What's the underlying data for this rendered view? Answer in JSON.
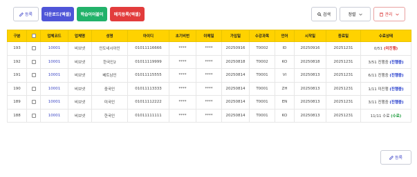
{
  "toolbar": {
    "register_label": "등록",
    "download_label": "다운로드(엑셀)",
    "study_label": "학습이어붙이",
    "bulk_register_label": "예치등록(엑셀)",
    "search_label": "검색",
    "sort_label": "정렬",
    "manage_label": "관리"
  },
  "colors": {
    "header_bg": "#ffd200",
    "accent": "#4f55d8",
    "green": "#22b26a",
    "red": "#e23c3c"
  },
  "table": {
    "columns": [
      "구분",
      "",
      "업체코드",
      "업체명",
      "성명",
      "아이디",
      "초기비번",
      "이메일",
      "가입일",
      "수강과목",
      "언어",
      "시작일",
      "종료일",
      "수료상태"
    ],
    "rows": [
      {
        "no": "193",
        "code": "10001",
        "company": "비브넷",
        "name": "인도네시아인",
        "id": "01011116666",
        "pw": "****",
        "email": "****",
        "joined": "20250916",
        "course": "T0002",
        "lang": "ID",
        "start": "20250916",
        "end": "20251231",
        "progress": "0/51",
        "status": "미진행",
        "status_type": "red"
      },
      {
        "no": "192",
        "code": "10001",
        "company": "비브넷",
        "name": "한국인2",
        "id": "01011119999",
        "pw": "****",
        "email": "****",
        "joined": "20250818",
        "course": "T0002",
        "lang": "KO",
        "start": "20250818",
        "end": "20251231",
        "progress": "3/51 진행중",
        "status": "진행중",
        "status_type": "blue"
      },
      {
        "no": "191",
        "code": "10001",
        "company": "비브넷",
        "name": "베트남인",
        "id": "01011115555",
        "pw": "****",
        "email": "****",
        "joined": "20250814",
        "course": "T0001",
        "lang": "VI",
        "start": "20250813",
        "end": "20251231",
        "progress": "6/11 진행중",
        "status": "진행중",
        "status_type": "blue"
      },
      {
        "no": "190",
        "code": "10001",
        "company": "비브넷",
        "name": "중국인",
        "id": "01011113333",
        "pw": "****",
        "email": "****",
        "joined": "20250814",
        "course": "T0001",
        "lang": "ZH",
        "start": "20250813",
        "end": "20251231",
        "progress": "1/11 미진행",
        "status": "진행중",
        "status_type": "blue"
      },
      {
        "no": "189",
        "code": "10001",
        "company": "비브넷",
        "name": "미국인",
        "id": "01011112222",
        "pw": "****",
        "email": "****",
        "joined": "20250814",
        "course": "T0001",
        "lang": "EN",
        "start": "20250813",
        "end": "20251231",
        "progress": "3/11 진행중",
        "status": "진행중",
        "status_type": "blue"
      },
      {
        "no": "188",
        "code": "10001",
        "company": "비브넷",
        "name": "한국인",
        "id": "01011111111",
        "pw": "****",
        "email": "****",
        "joined": "20250814",
        "course": "T0001",
        "lang": "KO",
        "start": "20250813",
        "end": "20251231",
        "progress": "11/11 수료",
        "status": "수료",
        "status_type": "green"
      }
    ]
  },
  "footer": {
    "register_label": "등록"
  }
}
